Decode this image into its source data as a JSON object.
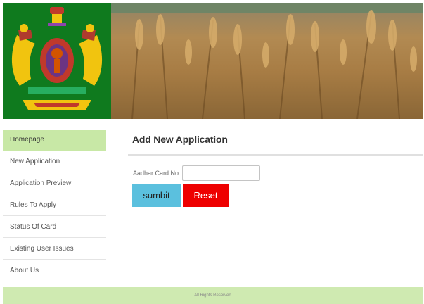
{
  "banner": {
    "emblem": "karnataka-state-emblem",
    "image": "wheat-field-photo"
  },
  "sidebar": {
    "items": [
      {
        "label": "Homepage",
        "active": true
      },
      {
        "label": "New Application"
      },
      {
        "label": "Application Preview"
      },
      {
        "label": "Rules To Apply"
      },
      {
        "label": "Status Of Card"
      },
      {
        "label": "Existing User Issues"
      },
      {
        "label": "About Us"
      }
    ]
  },
  "main": {
    "title": "Add New Application",
    "form": {
      "aadhar_label": "Aadhar Card No",
      "aadhar_value": "",
      "aadhar_placeholder": "",
      "submit_label": "sumbit",
      "reset_label": "Reset"
    }
  },
  "footer": {
    "text": "All Rights Reserved"
  },
  "colors": {
    "sidebar_active": "#c8e8a6",
    "footer_bg": "#cfeab1",
    "submit_bg": "#5bc0de",
    "reset_bg": "#ee0000",
    "emblem_bg": "#0f7a1e"
  }
}
